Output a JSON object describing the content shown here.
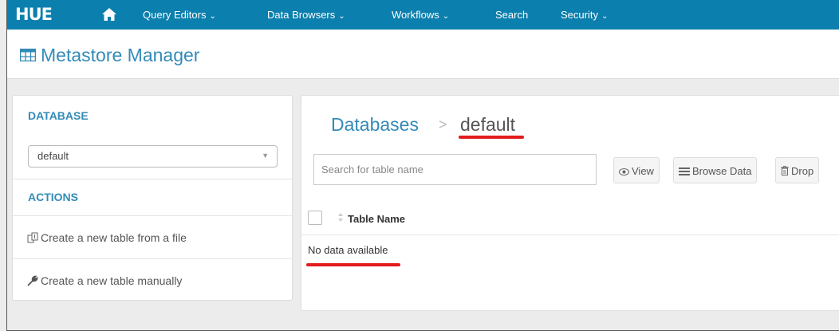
{
  "nav": {
    "logo": "HUE",
    "items": [
      {
        "label": "Query Editors",
        "dropdown": true
      },
      {
        "label": "Data Browsers",
        "dropdown": true
      },
      {
        "label": "Workflows",
        "dropdown": true
      },
      {
        "label": "Search",
        "dropdown": false
      },
      {
        "label": "Security",
        "dropdown": true
      }
    ],
    "caret": "⌄"
  },
  "header": {
    "title": "Metastore Manager",
    "icon": "table-grid-icon"
  },
  "sidebar": {
    "database_label": "DATABASE",
    "database_selected": "default",
    "actions_label": "ACTIONS",
    "actions": [
      {
        "label": "Create a new table from a file",
        "icon": "file-upload-icon"
      },
      {
        "label": "Create a new table manually",
        "icon": "wrench-icon"
      }
    ]
  },
  "main": {
    "breadcrumb": {
      "root": "Databases",
      "separator": ">",
      "current": "default"
    },
    "search_placeholder": "Search for table name",
    "buttons": {
      "view": "View",
      "browse_data": "Browse Data",
      "drop": "Drop"
    },
    "table": {
      "column_header": "Table Name",
      "empty_message": "No data available"
    }
  },
  "colors": {
    "navbar": "#0b7fad",
    "accent": "#338bb8",
    "annotation_red": "#e21b1b"
  }
}
